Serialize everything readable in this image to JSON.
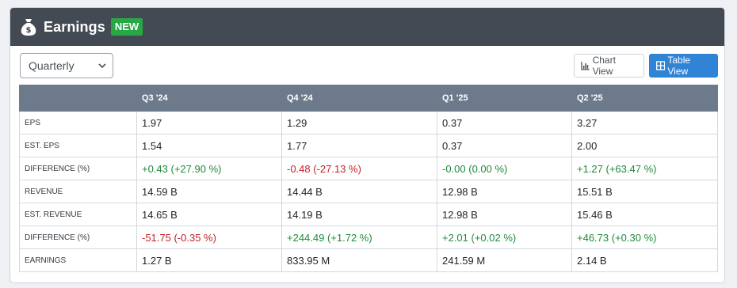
{
  "header": {
    "title": "Earnings",
    "badge": "NEW",
    "icon": "money-bag-icon"
  },
  "toolbar": {
    "period_select": "Quarterly",
    "chart_view_label": "Chart View",
    "table_view_label": "Table View"
  },
  "colors": {
    "header_bg": "#434a54",
    "badge_bg": "#28a745",
    "table_header_bg": "#6c7a8c",
    "active_button": "#2f84d6",
    "positive": "#1f8a3b",
    "negative": "#c51e2a"
  },
  "table": {
    "columns": [
      "",
      "Q3 '24",
      "Q4 '24",
      "Q1 '25",
      "Q2 '25"
    ],
    "rows": [
      {
        "label": "EPS",
        "values": [
          "1.97",
          "1.29",
          "0.37",
          "3.27"
        ],
        "tones": [
          "",
          "",
          "",
          ""
        ]
      },
      {
        "label": "EST. EPS",
        "values": [
          "1.54",
          "1.77",
          "0.37",
          "2.00"
        ],
        "tones": [
          "",
          "",
          "",
          ""
        ]
      },
      {
        "label": "DIFFERENCE (%)",
        "values": [
          "+0.43 (+27.90 %)",
          "-0.48 (-27.13 %)",
          "-0.00 (0.00 %)",
          "+1.27 (+63.47 %)"
        ],
        "tones": [
          "pos",
          "neg",
          "pos",
          "pos"
        ]
      },
      {
        "label": "REVENUE",
        "values": [
          "14.59 B",
          "14.44 B",
          "12.98 B",
          "15.51 B"
        ],
        "tones": [
          "",
          "",
          "",
          ""
        ]
      },
      {
        "label": "EST. REVENUE",
        "values": [
          "14.65 B",
          "14.19 B",
          "12.98 B",
          "15.46 B"
        ],
        "tones": [
          "",
          "",
          "",
          ""
        ]
      },
      {
        "label": "DIFFERENCE (%)",
        "values": [
          "-51.75 (-0.35 %)",
          "+244.49 (+1.72 %)",
          "+2.01 (+0.02 %)",
          "+46.73 (+0.30 %)"
        ],
        "tones": [
          "neg",
          "pos",
          "pos",
          "pos"
        ]
      },
      {
        "label": "EARNINGS",
        "values": [
          "1.27 B",
          "833.95 M",
          "241.59 M",
          "2.14 B"
        ],
        "tones": [
          "",
          "",
          "",
          ""
        ]
      }
    ]
  }
}
